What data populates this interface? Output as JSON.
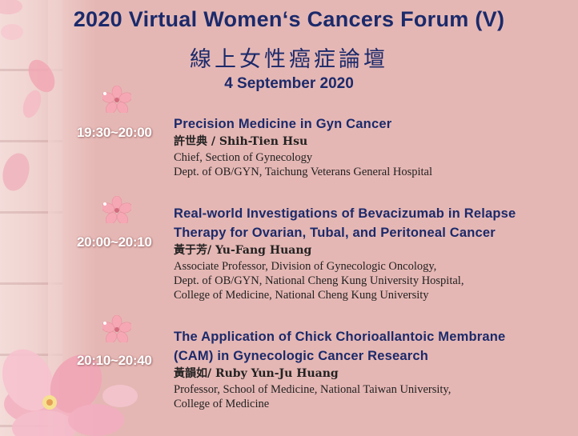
{
  "header": {
    "title": "2020 Virtual Women‘s Cancers Forum (V)",
    "title_cn": "線上女性癌症論壇",
    "date": "4 September 2020"
  },
  "sessions": [
    {
      "time": "19:30~20:00",
      "title_lines": [
        "Precision Medicine in Gyn Cancer"
      ],
      "speaker": "許世典 / Shih-Tien Hsu",
      "affiliation_lines": [
        "Chief, Section of Gynecology",
        "Dept. of OB/GYN, Taichung Veterans General Hospital"
      ]
    },
    {
      "time": "20:00~20:10",
      "title_lines": [
        "Real-world Investigations of Bevacizumab in Relapse",
        "Therapy for Ovarian, Tubal, and Peritoneal Cancer"
      ],
      "speaker": "黃于芳/ Yu-Fang Huang",
      "affiliation_lines": [
        "Associate Professor, Division of Gynecologic Oncology,",
        "Dept. of OB/GYN, National Cheng Kung University Hospital,",
        "College of Medicine, National Cheng Kung University"
      ]
    },
    {
      "time": "20:10~20:40",
      "title_lines": [
        "The Application of Chick Chorioallantoic Membrane",
        "(CAM) in Gynecologic Cancer Research"
      ],
      "speaker": "黃韻如/ Ruby Yun-Ju Huang",
      "affiliation_lines": [
        "Professor, School of Medicine, National Taiwan University,",
        "College of Medicine"
      ]
    }
  ],
  "colors": {
    "background": "#e5b7b4",
    "title": "#1b2a6b",
    "time_text": "#ffffff"
  },
  "icons": [
    "cherry-blossom-icon"
  ]
}
